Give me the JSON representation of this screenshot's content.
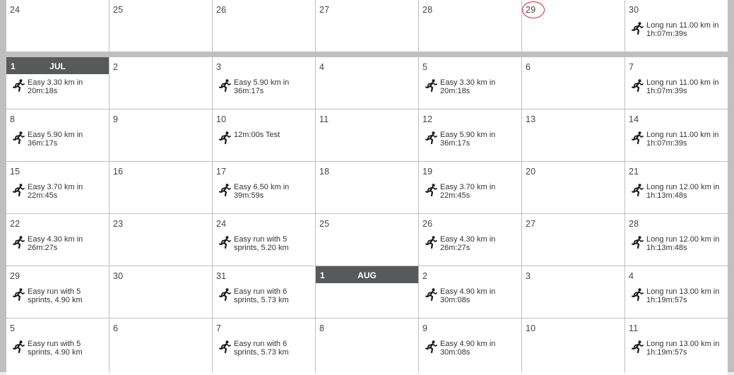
{
  "calendar": {
    "accent_today": "#e0202a",
    "month_bar_color": "#58595b",
    "icon": "runner-icon",
    "weeks": [
      [
        {
          "day": "24"
        },
        {
          "day": "25"
        },
        {
          "day": "26"
        },
        {
          "day": "27"
        },
        {
          "day": "28"
        },
        {
          "day": "29",
          "today": true
        },
        {
          "day": "30",
          "activity": "Long run 11.00 km in 1h:07m:39s"
        }
      ],
      [
        {
          "day": "1",
          "month": "JUL",
          "activity": "Easy 3.30 km in 20m:18s"
        },
        {
          "day": "2"
        },
        {
          "day": "3",
          "activity": "Easy 5.90 km in 36m:17s"
        },
        {
          "day": "4"
        },
        {
          "day": "5",
          "activity": "Easy 3.30 km in 20m:18s"
        },
        {
          "day": "6"
        },
        {
          "day": "7",
          "activity": "Long run 11.00 km in 1h:07m:39s"
        }
      ],
      [
        {
          "day": "8",
          "activity": "Easy 5.90 km in 36m:17s"
        },
        {
          "day": "9"
        },
        {
          "day": "10",
          "activity": "12m:00s Test"
        },
        {
          "day": "11"
        },
        {
          "day": "12",
          "activity": "Easy 5.90 km in 36m:17s"
        },
        {
          "day": "13"
        },
        {
          "day": "14",
          "activity": "Long run 11.00 km in 1h:07m:39s"
        }
      ],
      [
        {
          "day": "15",
          "activity": "Easy 3.70 km in 22m:45s"
        },
        {
          "day": "16"
        },
        {
          "day": "17",
          "activity": "Easy 6.50 km in 39m:59s"
        },
        {
          "day": "18"
        },
        {
          "day": "19",
          "activity": "Easy 3.70 km in 22m:45s"
        },
        {
          "day": "20"
        },
        {
          "day": "21",
          "activity": "Long run 12.00 km in 1h:13m:48s"
        }
      ],
      [
        {
          "day": "22",
          "activity": "Easy 4.30 km in 26m:27s"
        },
        {
          "day": "23"
        },
        {
          "day": "24",
          "activity": "Easy run with 5 sprints, 5.20 km"
        },
        {
          "day": "25"
        },
        {
          "day": "26",
          "activity": "Easy 4.30 km in 26m:27s"
        },
        {
          "day": "27"
        },
        {
          "day": "28",
          "activity": "Long run 12.00 km in 1h:13m:48s"
        }
      ],
      [
        {
          "day": "29",
          "activity": "Easy run with 5 sprints, 4.90 km"
        },
        {
          "day": "30"
        },
        {
          "day": "31",
          "activity": "Easy run with 6 sprints, 5.73 km"
        },
        {
          "day": "1",
          "month": "AUG"
        },
        {
          "day": "2",
          "activity": "Easy 4.90 km in 30m:08s"
        },
        {
          "day": "3"
        },
        {
          "day": "4",
          "activity": "Long run 13.00 km in 1h:19m:57s"
        }
      ],
      [
        {
          "day": "5",
          "activity": "Easy run with 5 sprints, 4.90 km"
        },
        {
          "day": "6"
        },
        {
          "day": "7",
          "activity": "Easy run with 6 sprints, 5.73 km"
        },
        {
          "day": "8"
        },
        {
          "day": "9",
          "activity": "Easy 4.90 km in 30m:08s"
        },
        {
          "day": "10"
        },
        {
          "day": "11",
          "activity": "Long run 13.00 km in 1h:19m:57s"
        }
      ]
    ]
  }
}
